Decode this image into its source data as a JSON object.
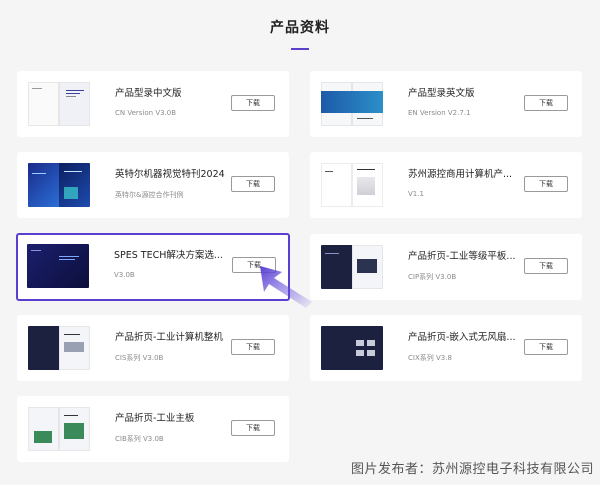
{
  "page": {
    "title": "产品资料",
    "accent_color": "#5b3fc9",
    "highlight_color": "#5a3fd0"
  },
  "download_label": "下载",
  "cards": [
    {
      "title": "产品型录中文版",
      "subtitle": "CN Version V3.0B",
      "thumb": "catalog-cn"
    },
    {
      "title": "产品型录英文版",
      "subtitle": "EN Version V2.7.1",
      "thumb": "catalog-en"
    },
    {
      "title": "英特尔机器视觉特刊2024",
      "subtitle": "英特尔&源控合作刊例",
      "thumb": "intel-vision"
    },
    {
      "title": "苏州源控商用计算机产...",
      "subtitle": "V1.1",
      "thumb": "commercial-pc"
    },
    {
      "title": "SPES TECH解决方案选...",
      "subtitle": "V3.0B",
      "thumb": "spes-solutions"
    },
    {
      "title": "产品折页-工业等级平板...",
      "subtitle": "CIP系列 V3.0B",
      "thumb": "cip-tablet"
    },
    {
      "title": "产品折页-工业计算机整机",
      "subtitle": "CIS系列 V3.0B",
      "thumb": "cis-computer"
    },
    {
      "title": "产品折页-嵌入式无风扇...",
      "subtitle": "CIX系列 V3.8",
      "thumb": "cix-fanless"
    },
    {
      "title": "产品折页-工业主板",
      "subtitle": "CIB系列 V3.0B",
      "thumb": "cib-board"
    }
  ],
  "watermark": "图片发布者：苏州源控电子科技有限公司"
}
